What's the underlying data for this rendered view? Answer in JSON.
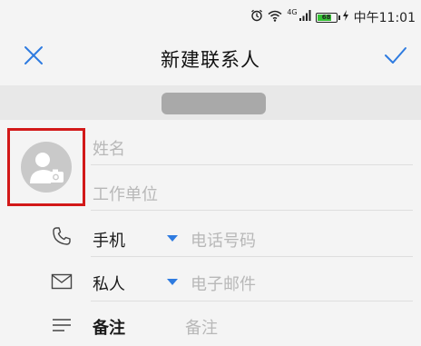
{
  "status_bar": {
    "network": "4G",
    "battery": "68",
    "time": "中午11:01"
  },
  "header": {
    "title": "新建联系人"
  },
  "form": {
    "name_placeholder": "姓名",
    "company_placeholder": "工作单位",
    "phone": {
      "type_label": "手机",
      "placeholder": "电话号码"
    },
    "email": {
      "type_label": "私人",
      "placeholder": "电子邮件"
    },
    "note": {
      "label": "备注",
      "placeholder": "备注"
    }
  },
  "colors": {
    "accent": "#2e7be0",
    "highlight_border": "#d21919",
    "battery_fill": "#35c135"
  },
  "icons": [
    "alarm-icon",
    "wifi-icon",
    "signal-icon",
    "battery-icon",
    "charging-icon",
    "close-icon",
    "check-icon",
    "avatar-camera-icon",
    "phone-icon",
    "mail-icon",
    "notes-icon",
    "dropdown-caret-icon"
  ]
}
